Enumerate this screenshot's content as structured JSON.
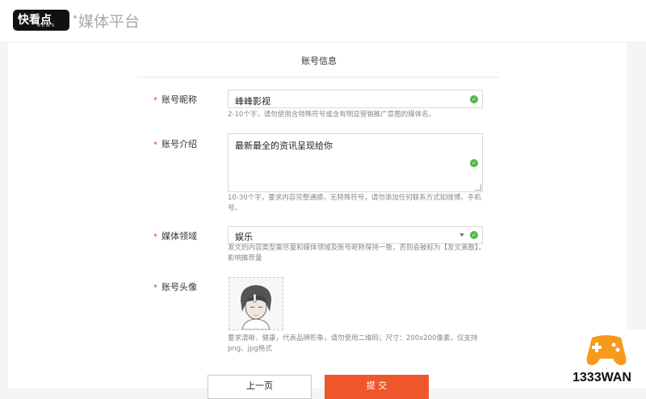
{
  "header": {
    "logo_text": "快看点",
    "logo_sub": "NEWS",
    "platform_title": "媒体平台"
  },
  "section": {
    "title": "账号信息"
  },
  "form": {
    "required_mark": "*",
    "nickname": {
      "label": "账号昵称",
      "value": "峰峰影视",
      "hint": "2-10个字，请勿使用含特殊符号或含有明显营销推广意图的媒体名。"
    },
    "intro": {
      "label": "账号介绍",
      "value": "最新最全的资讯呈现给你",
      "hint": "10-30个字，要求内容完整通顺，无特殊符号，请勿添加任何联系方式如微博、手机号。"
    },
    "domain": {
      "label": "媒体领域",
      "value": "娱乐",
      "hint": "发文的内容类型需尽量和媒体领域及账号昵称保持一致，否则会被标为【发文离散】，影响推荐量"
    },
    "avatar": {
      "label": "账号头像",
      "hint": "要求清晰、健康，代表品牌形象，请勿使用二维码；尺寸：200x200像素，仅支持png、jpg格式"
    }
  },
  "buttons": {
    "prev": "上一页",
    "submit": "提 交"
  },
  "watermark": {
    "text": "1333WAN"
  },
  "colors": {
    "accent": "#f0562c",
    "required": "#e8452f",
    "valid": "#52b84c",
    "watermark": "#f59a1b"
  },
  "icons": {
    "valid": "check-circle-icon",
    "dropdown": "chevron-down-icon",
    "watermark": "gamepad-icon"
  }
}
